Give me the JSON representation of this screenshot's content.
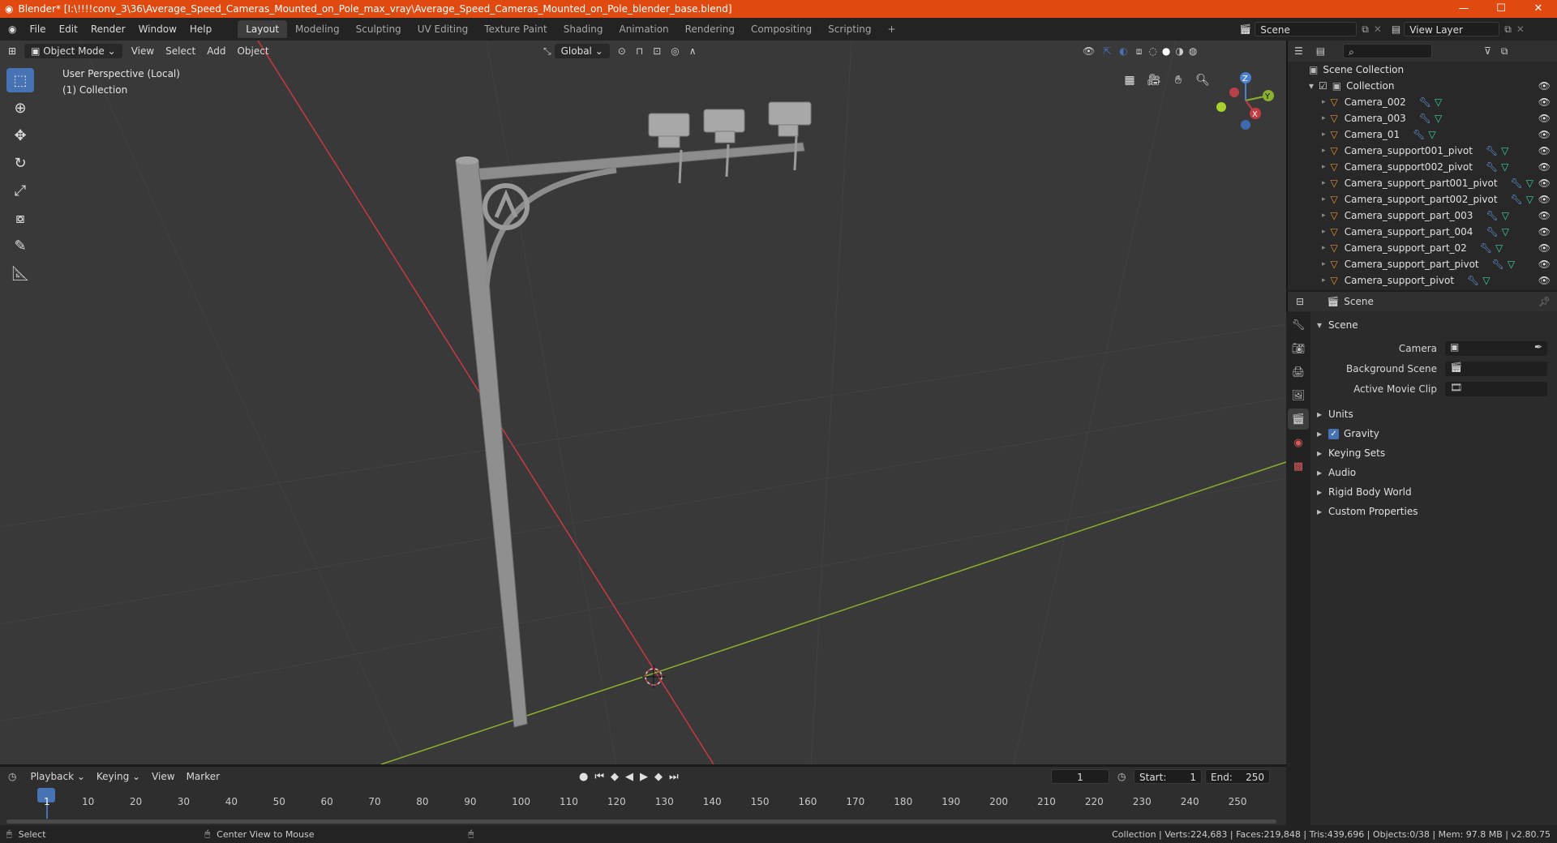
{
  "window": {
    "title": "Blender* [I:\\!!!!conv_3\\36\\Average_Speed_Cameras_Mounted_on_Pole_max_vray\\Average_Speed_Cameras_Mounted_on_Pole_blender_base.blend]",
    "min": "—",
    "max": "☐",
    "close": "✕"
  },
  "menu": {
    "items": [
      "File",
      "Edit",
      "Render",
      "Window",
      "Help"
    ],
    "workspaces": [
      "Layout",
      "Modeling",
      "Sculpting",
      "UV Editing",
      "Texture Paint",
      "Shading",
      "Animation",
      "Rendering",
      "Compositing",
      "Scripting"
    ],
    "add_tab": "+",
    "scene_label": "Scene",
    "view_layer_label": "View Layer"
  },
  "viewport_header": {
    "mode": "Object Mode",
    "menus": [
      "View",
      "Select",
      "Add",
      "Object"
    ],
    "orientation": "Global"
  },
  "viewport": {
    "perspective": "User Perspective (Local)",
    "collection": "(1) Collection",
    "axes": {
      "x": "X",
      "y": "Y",
      "z": "Z"
    }
  },
  "outliner": {
    "root": "Scene Collection",
    "collection": "Collection",
    "objects": [
      {
        "name": "Camera_002"
      },
      {
        "name": "Camera_003"
      },
      {
        "name": "Camera_01"
      },
      {
        "name": "Camera_support001_pivot"
      },
      {
        "name": "Camera_support002_pivot"
      },
      {
        "name": "Camera_support_part001_pivot"
      },
      {
        "name": "Camera_support_part002_pivot"
      },
      {
        "name": "Camera_support_part_003"
      },
      {
        "name": "Camera_support_part_004"
      },
      {
        "name": "Camera_support_part_02"
      },
      {
        "name": "Camera_support_part_pivot"
      },
      {
        "name": "Camera_support_pivot"
      }
    ]
  },
  "properties": {
    "context": "Scene",
    "panel": "Scene",
    "fields": [
      {
        "label": "Camera"
      },
      {
        "label": "Background Scene"
      },
      {
        "label": "Active Movie Clip"
      }
    ],
    "sections": [
      "Units",
      "Gravity",
      "Keying Sets",
      "Audio",
      "Rigid Body World",
      "Custom Properties"
    ],
    "gravity_checked": true
  },
  "timeline": {
    "menus": [
      "Playback",
      "Keying",
      "View",
      "Marker"
    ],
    "current_frame": "1",
    "start_label": "Start:",
    "start": "1",
    "end_label": "End:",
    "end": "250",
    "ticks": [
      "1",
      "10",
      "20",
      "30",
      "40",
      "50",
      "60",
      "70",
      "80",
      "90",
      "100",
      "110",
      "120",
      "130",
      "140",
      "150",
      "160",
      "170",
      "180",
      "190",
      "200",
      "210",
      "220",
      "230",
      "240",
      "250"
    ]
  },
  "statusbar": {
    "select": "Select",
    "center_view": "Center View to Mouse",
    "stats": "Collection | Verts:224,683 | Faces:219,848 | Tris:439,696 | Objects:0/38 | Mem: 97.8 MB | v2.80.75"
  },
  "colors": {
    "titlebar": "#e0490f",
    "viewport_bg": "#393939",
    "x_axis": "#c63a44",
    "y_axis": "#8ab02d",
    "accent": "#4772b3",
    "object_icon": "#e8903a",
    "modifier_icon": "#6a9ee8",
    "mesh_icon": "#3ed1a6"
  }
}
